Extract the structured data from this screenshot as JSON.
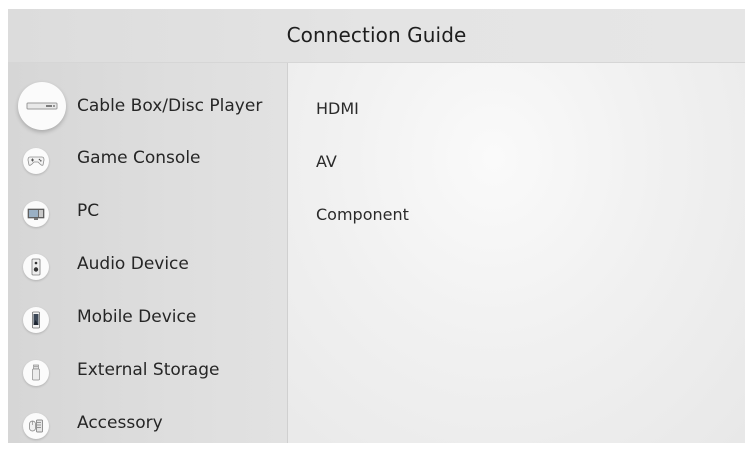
{
  "header": {
    "title": "Connection Guide"
  },
  "sidebar": {
    "items": [
      {
        "label": "Cable Box/Disc Player",
        "icon": "cable-box-icon",
        "selected": true
      },
      {
        "label": "Game Console",
        "icon": "game-controller-icon",
        "selected": false
      },
      {
        "label": "PC",
        "icon": "monitor-icon",
        "selected": false
      },
      {
        "label": "Audio Device",
        "icon": "speaker-icon",
        "selected": false
      },
      {
        "label": "Mobile Device",
        "icon": "smartphone-icon",
        "selected": false
      },
      {
        "label": "External Storage",
        "icon": "usb-drive-icon",
        "selected": false
      },
      {
        "label": "Accessory",
        "icon": "keyboard-mouse-icon",
        "selected": false
      }
    ]
  },
  "content": {
    "connections": [
      {
        "label": "HDMI"
      },
      {
        "label": "AV"
      },
      {
        "label": "Component"
      }
    ]
  },
  "colors": {
    "background": "#ebebeb",
    "header_background": "#e2e2e2",
    "sidebar_background": "#dcdcdc",
    "text": "#262626",
    "icon_background": "#fbfbfb"
  }
}
